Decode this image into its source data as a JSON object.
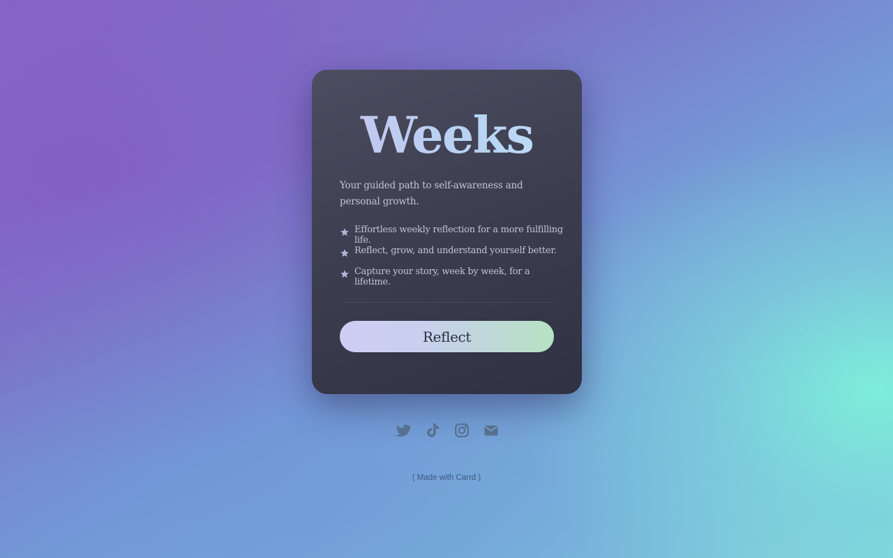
{
  "card": {
    "title": "Weeks",
    "tagline": "Your guided path to self-awareness and personal growth.",
    "features": [
      {
        "icon": "star-icon",
        "text": "Effortless weekly reflection for a more fulfilling life."
      },
      {
        "icon": "star-icon",
        "text": "Reflect, grow, and understand yourself better."
      },
      {
        "icon": "star-icon",
        "text": "Capture your story, week by week, for a lifetime."
      }
    ],
    "cta_label": "Reflect"
  },
  "socials": [
    {
      "icon": "twitter-icon"
    },
    {
      "icon": "tiktok-icon"
    },
    {
      "icon": "instagram-icon"
    },
    {
      "icon": "email-icon"
    }
  ],
  "footer": {
    "credit": "( Made with Carrd )"
  },
  "colors": {
    "card_bg": "#3c3d4f",
    "title_gradient_start": "#c7c3ef",
    "title_gradient_end": "#c0e0f8",
    "button_gradient_start": "#cfcdf5",
    "button_gradient_end": "#b6e2c2",
    "icon_color": "#56708f"
  }
}
